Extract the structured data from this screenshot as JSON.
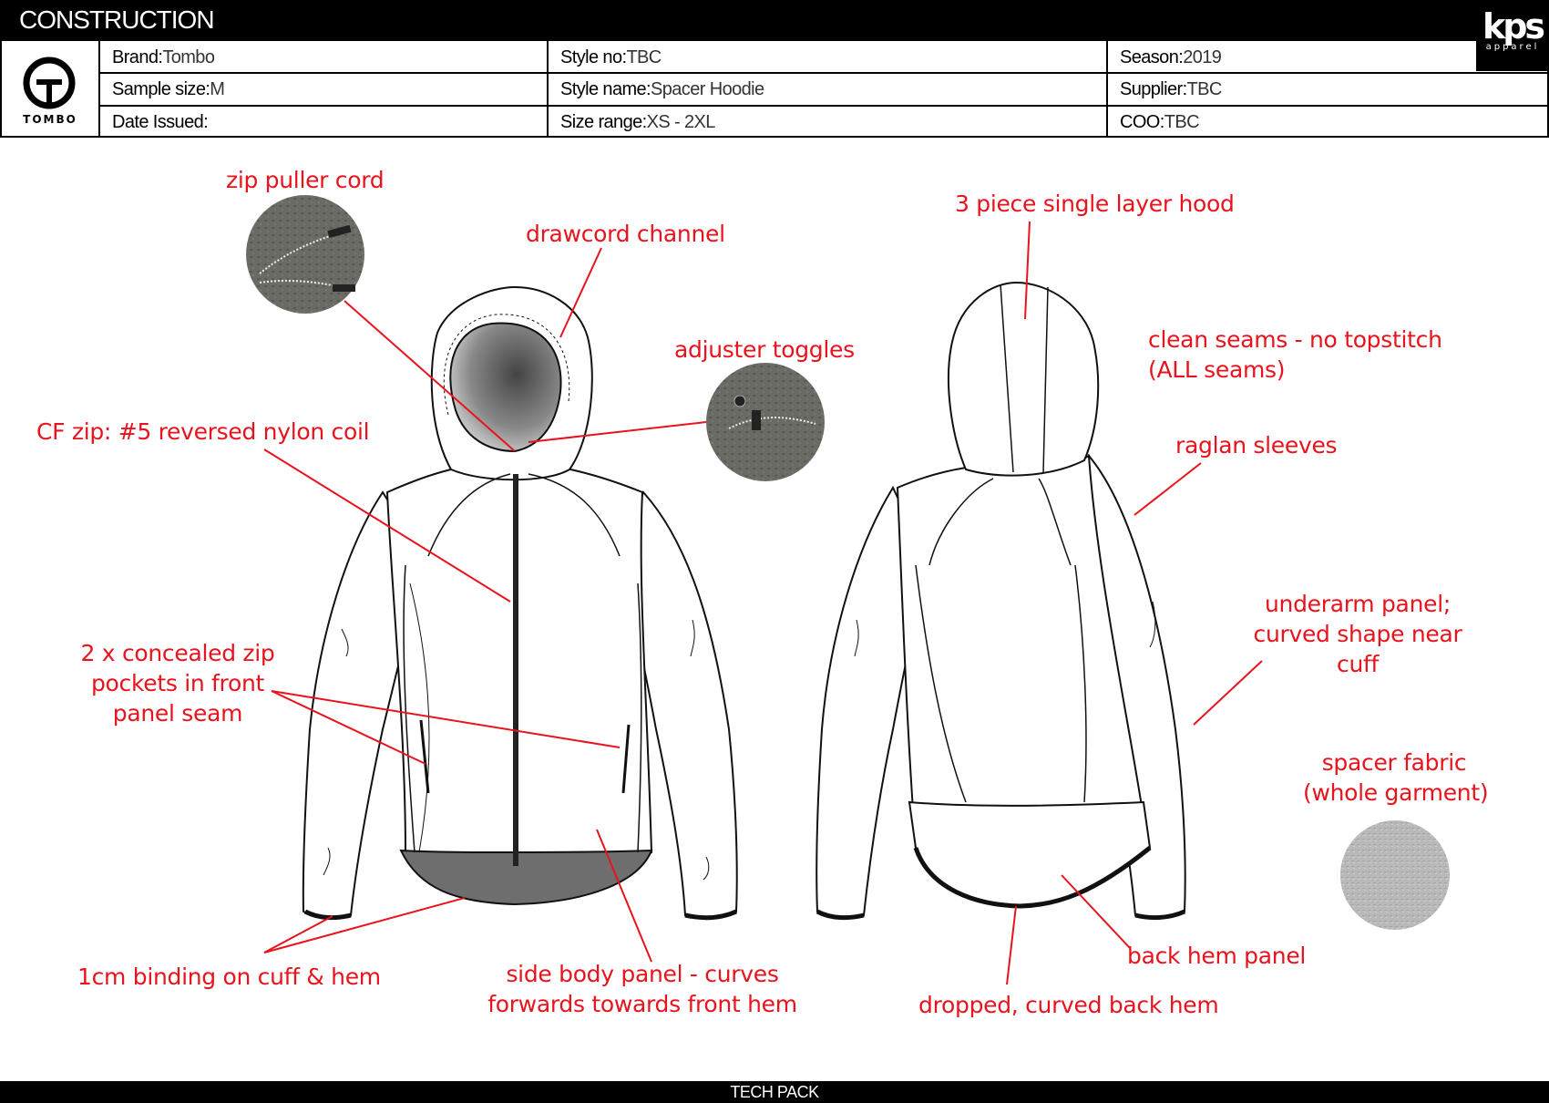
{
  "header": {
    "title": "CONSTRUCTION",
    "brand_logo_text": "TOMBO",
    "supplier_logo_main": "kps",
    "supplier_logo_sub": "apparel"
  },
  "info": {
    "brand": {
      "label": "Brand:",
      "value": "Tombo"
    },
    "style_no": {
      "label": "Style no:",
      "value": "TBC"
    },
    "season": {
      "label": "Season:",
      "value": "2019"
    },
    "sample_size": {
      "label": "Sample size:",
      "value": "M"
    },
    "style_name": {
      "label": "Style name:",
      "value": "Spacer Hoodie"
    },
    "supplier": {
      "label": "Supplier:",
      "value": "TBC"
    },
    "date_issued": {
      "label": "Date Issued:",
      "value": ""
    },
    "size_range": {
      "label": "Size range:",
      "value": "XS - 2XL"
    },
    "coo": {
      "label": "COO:",
      "value": "TBC"
    }
  },
  "annotations": {
    "zip_puller": "zip puller cord",
    "drawcord": "drawcord channel",
    "toggles": "adjuster toggles",
    "cf_zip": "CF zip: #5 reversed nylon coil",
    "pockets_1": "2 x concealed zip",
    "pockets_2": "pockets in front",
    "pockets_3": "panel seam",
    "binding": "1cm binding on cuff & hem",
    "side_panel_1": "side body panel - curves",
    "side_panel_2": "forwards towards front hem",
    "hood": "3 piece single layer hood",
    "clean_1": "clean seams - no topstitch",
    "clean_2": "(ALL seams)",
    "raglan": "raglan sleeves",
    "underarm_1": "underarm panel;",
    "underarm_2": "curved shape near",
    "underarm_3": "cuff",
    "spacer_1": "spacer fabric",
    "spacer_2": "(whole garment)",
    "back_hem_panel": "back hem panel",
    "dropped_hem": "dropped, curved back hem"
  },
  "footer": {
    "label": "TECH PACK"
  },
  "colors": {
    "annotation": "#e8131c",
    "hem_fill": "#6e6e6e",
    "fabric_swatch": "#b9b9b9"
  }
}
